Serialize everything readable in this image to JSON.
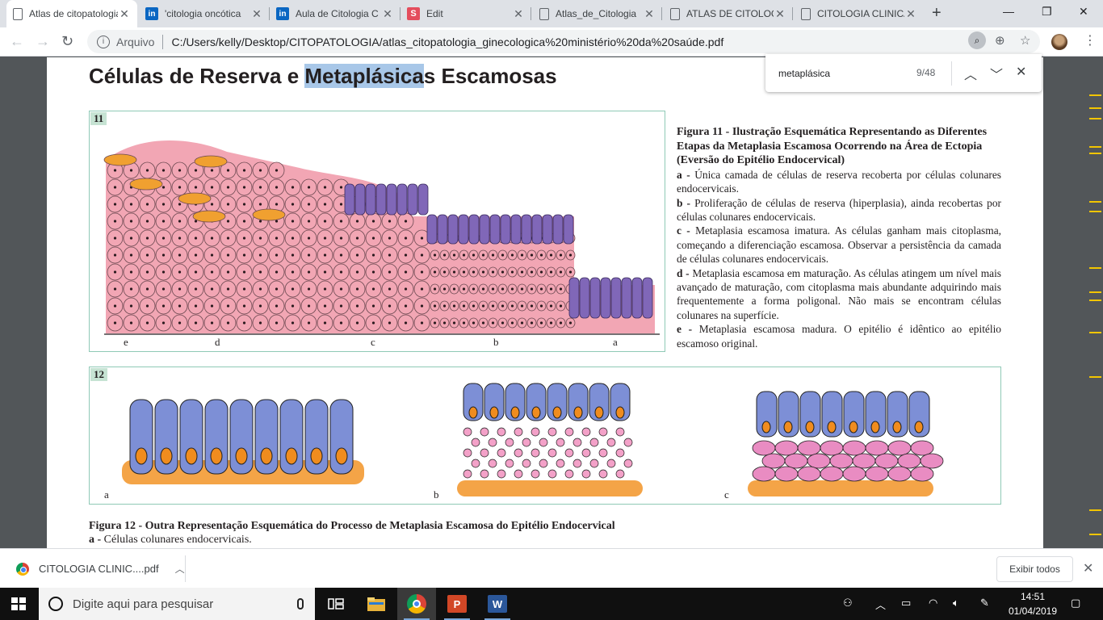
{
  "tabs": [
    {
      "title": "Atlas de citopatologia",
      "favicon": "document-icon",
      "active": true
    },
    {
      "title": "'citologia oncótica",
      "favicon": "linkedin-icon"
    },
    {
      "title": "Aula de Citologia C",
      "favicon": "linkedin-icon"
    },
    {
      "title": "Edit",
      "favicon": "s-app-icon"
    },
    {
      "title": "Atlas_de_Citologia",
      "favicon": "document-icon"
    },
    {
      "title": "ATLAS DE CITOLOGIA",
      "favicon": "document-icon"
    },
    {
      "title": "CITOLOGIA CLINICA",
      "favicon": "document-icon"
    }
  ],
  "toolbar": {
    "scheme": "Arquivo",
    "url": "C:/Users/kelly/Desktop/CITOPATOLOGIA/atlas_citopatologia_ginecologica%20ministério%20da%20saúde.pdf"
  },
  "find": {
    "query": "metaplásica",
    "count": "9/48"
  },
  "doc": {
    "heading_pre": "Células de Reserva e ",
    "heading_hl": "Metaplásica",
    "heading_post": "s Escamosas",
    "fig11": {
      "number": "11",
      "labels": [
        "e",
        "d",
        "c",
        "b",
        "a"
      ],
      "title": "Figura 11 - Ilustração Esquemática Representando as Diferentes Etapas da Metaplasia Escamosa Ocorrendo na Área de Ectopia (Eversão do Epitélio Endocervical)",
      "items": [
        {
          "key": "a -",
          "text": "Única camada de células de reserva recoberta por células colunares endocervicais."
        },
        {
          "key": "b -",
          "text": "Proliferação de células de reserva (hiperplasia), ainda recobertas por células colunares endocervicais."
        },
        {
          "key": "c -",
          "text": "Metaplasia escamosa imatura. As células ganham mais citoplasma, começando a diferenciação escamosa. Observar a persistência da camada de células colunares endocervicais."
        },
        {
          "key": "d -",
          "text": "Metaplasia escamosa em maturação. As células atingem um nível mais avançado de maturação, com citoplasma mais abundante adquirindo mais frequentemente a forma poligonal. Não mais se encontram células colunares na superfície."
        },
        {
          "key": "e -",
          "text": "Metaplasia escamosa madura. O epitélio é idêntico ao epitélio escamoso original."
        }
      ]
    },
    "fig12": {
      "number": "12",
      "labels": [
        "a",
        "b",
        "c"
      ],
      "title": "Figura 12 - Outra Representação Esquemática do Processo de Metaplasia Escamosa do Epitélio Endocervical",
      "item_a_key": "a -",
      "item_a_text": "Células colunares endocervicais."
    }
  },
  "download": {
    "filename": "CITOLOGIA CLINIC....pdf",
    "show_all": "Exibir todos"
  },
  "taskbar": {
    "search_placeholder": "Digite aqui para pesquisar",
    "time": "14:51",
    "date": "01/04/2019"
  },
  "colors": {
    "highlight": "#a8c7e8",
    "find_mark": "#f2c500",
    "figure_frame": "#8fc9b6"
  }
}
